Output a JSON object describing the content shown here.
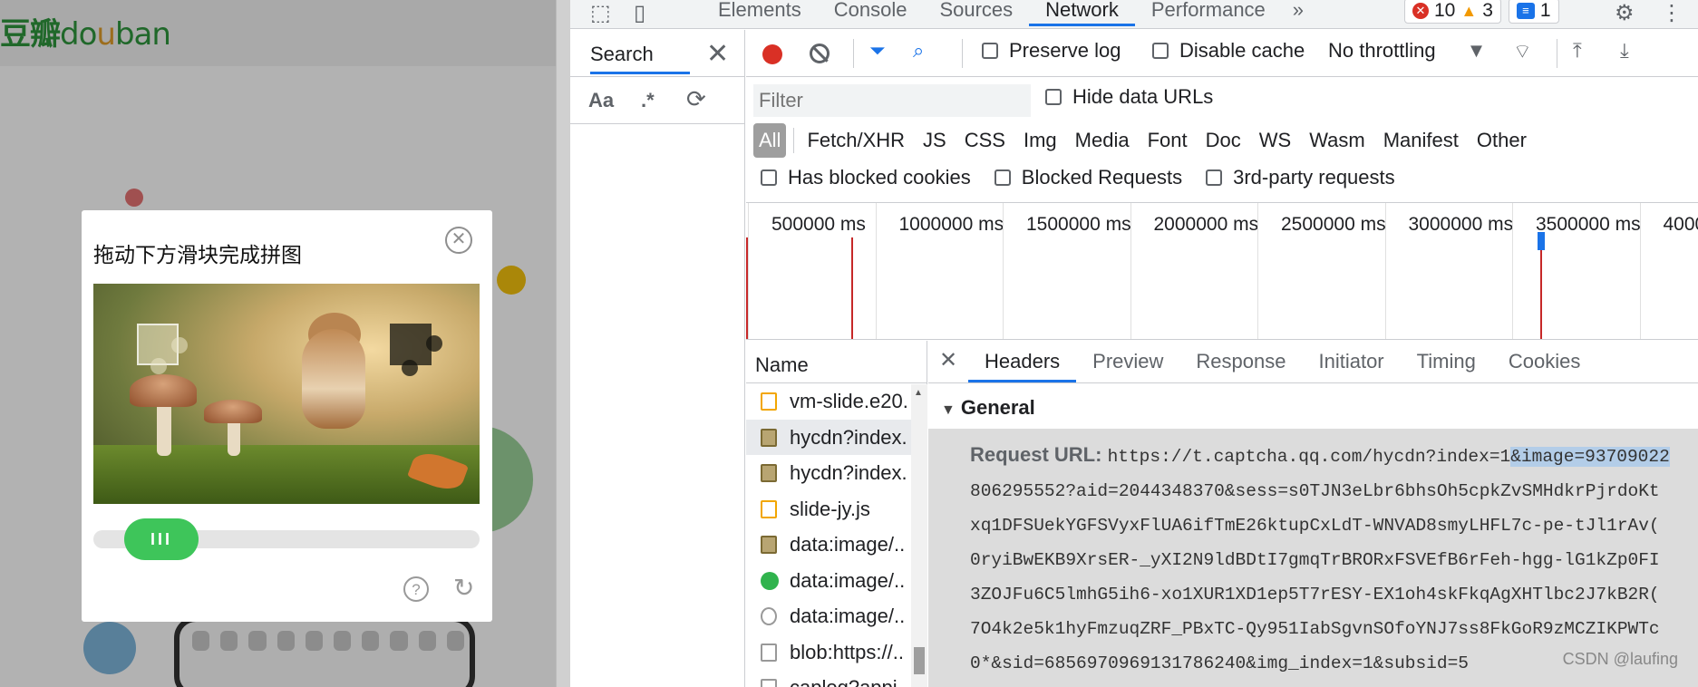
{
  "page": {
    "logo_cn": "豆瓣",
    "logo_en_a": "do",
    "logo_en_b": "u",
    "logo_en_c": "ban"
  },
  "captcha": {
    "title": "拖动下方滑块完成拼图",
    "close_glyph": "✕",
    "slider_glyph": "III",
    "help_glyph": "?",
    "refresh_glyph": "↻"
  },
  "devtools": {
    "tabs": [
      "Elements",
      "Console",
      "Sources",
      "Network",
      "Performance"
    ],
    "active_tab": "Network",
    "more_glyph": "»",
    "errors": "10",
    "warnings": "3",
    "messages": "1",
    "search": {
      "title": "Search",
      "close": "✕",
      "case": "Aa",
      "regex": ".*",
      "refresh": "⟳"
    },
    "toolbar": {
      "preserve_log": "Preserve log",
      "disable_cache": "Disable cache",
      "throttling": "No throttling"
    },
    "filter": {
      "placeholder": "Filter",
      "hide_data_urls": "Hide data URLs"
    },
    "types": [
      "All",
      "Fetch/XHR",
      "JS",
      "CSS",
      "Img",
      "Media",
      "Font",
      "Doc",
      "WS",
      "Wasm",
      "Manifest",
      "Other"
    ],
    "checks": [
      "Has blocked cookies",
      "Blocked Requests",
      "3rd-party requests"
    ],
    "overview_labels": [
      "500000 ms",
      "1000000 ms",
      "1500000 ms",
      "2000000 ms",
      "2500000 ms",
      "3000000 ms",
      "3500000 ms",
      "4000"
    ],
    "requests_header": "Name",
    "requests": [
      {
        "name": "vm-slide.e20.",
        "icon": "js"
      },
      {
        "name": "hycdn?index.",
        "icon": "img",
        "selected": true
      },
      {
        "name": "hycdn?index.",
        "icon": "img"
      },
      {
        "name": "slide-jy.js",
        "icon": "js"
      },
      {
        "name": "data:image/..",
        "icon": "img"
      },
      {
        "name": "data:image/..",
        "icon": "ok"
      },
      {
        "name": "data:image/..",
        "icon": "ban"
      },
      {
        "name": "blob:https://..",
        "icon": "doc"
      },
      {
        "name": "caplog?appi..",
        "icon": "doc"
      }
    ],
    "detail_tabs": [
      "Headers",
      "Preview",
      "Response",
      "Initiator",
      "Timing",
      "Cookies"
    ],
    "active_detail_tab": "Headers",
    "general_label": "General",
    "request_url_label": "Request URL:",
    "request_url_lines": [
      "https://t.captcha.qq.com/hycdn?index=1",
      "806295552?aid=2044348370&sess=s0TJN3eLbr6bhsOh5cpkZvSMHdkrPjrdoKt",
      "xq1DFSUekYGFSVyxFlUA6ifTmE26ktupCxLdT-WNVAD8smyLHFL7c-pe-tJl1rAv(",
      "0ryiBwEKB9XrsER-_yXI2N9ldBDtI7gmqTrBRORxFSVEfB6rFeh-hgg-lG1kZp0FI",
      "3ZOJFu6C5lmhG5ih6-xo1XUR1XD1ep5T7rESY-EX1oh4skFkqAgXHTlbc2J7kB2R(",
      "7O4k2e5k1hyFmzuqZRF_PBxTC-Qy951IabSgvnSOfoYNJ7ss8FkGoR9zMCZIKPWTc",
      "0*&sid=6856970969131786240&img_index=1&subsid=5"
    ],
    "request_url_highlight": "&image=93709022",
    "watermark": "CSDN @laufing"
  }
}
